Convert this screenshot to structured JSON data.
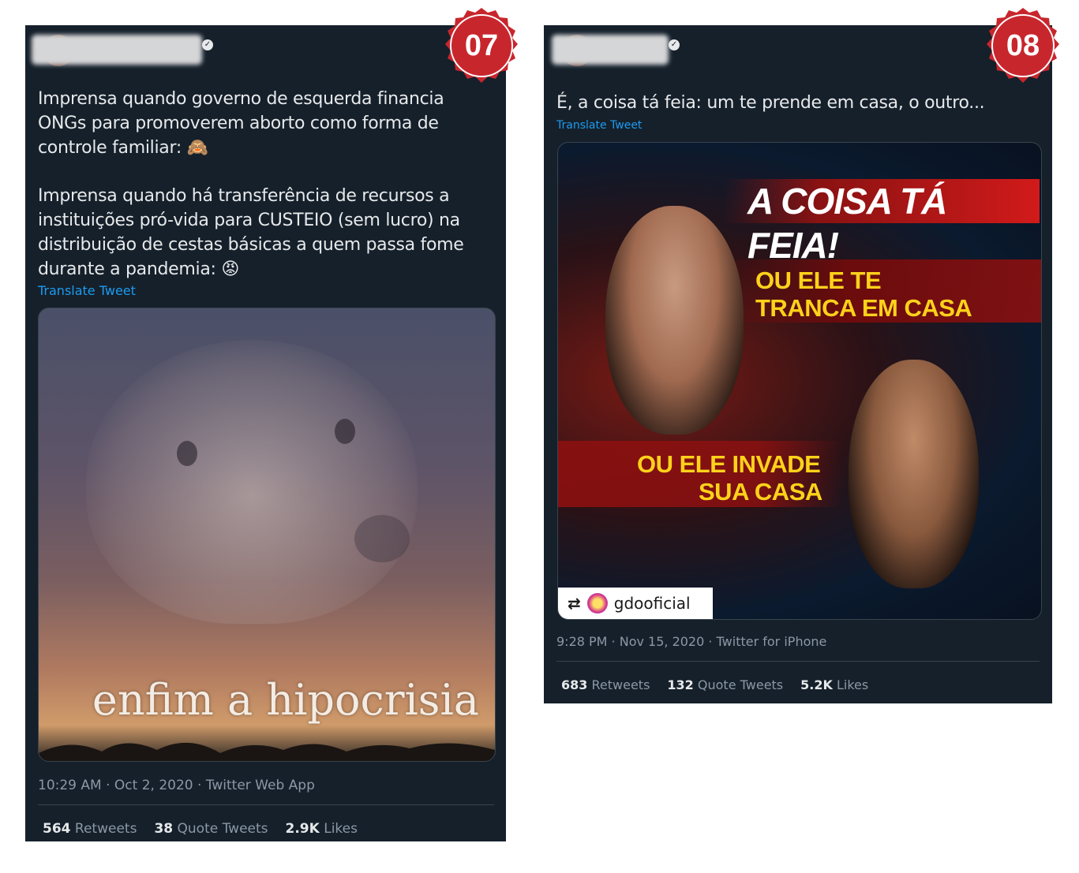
{
  "tweets": [
    {
      "badge": "07",
      "text_paragraphs": [
        "Imprensa quando governo de esquerda financia ONGs para promoverem aborto como forma de controle familiar: 🙈",
        "Imprensa quando há transferência de recursos a instituições pró-vida para CUSTEIO (sem lucro) na distribuição de cestas básicas a quem passa fome durante a pandemia: 😡"
      ],
      "translate_label": "Translate Tweet",
      "image_caption": "enfim a hipocrisia",
      "timestamp": "10:29 AM · Oct 2, 2020 · Twitter Web App",
      "stats": {
        "retweets_count": "564",
        "retweets_label": "Retweets",
        "quotes_count": "38",
        "quotes_label": "Quote Tweets",
        "likes_count": "2.9K",
        "likes_label": "Likes"
      }
    },
    {
      "badge": "08",
      "text_paragraphs": [
        "É, a coisa tá feia: um te prende em casa, o outro..."
      ],
      "translate_label": "Translate Tweet",
      "image_headline": "A COISA TÁ FEIA!",
      "image_line1": "OU ELE TE",
      "image_line2": "TRANCA EM CASA",
      "image_line3": "OU ELE INVADE",
      "image_line4": "SUA CASA",
      "attribution_handle": "gdooficial",
      "timestamp": "9:28 PM · Nov 15, 2020 · Twitter for iPhone",
      "stats": {
        "retweets_count": "683",
        "retweets_label": "Retweets",
        "quotes_count": "132",
        "quotes_label": "Quote Tweets",
        "likes_count": "5.2K",
        "likes_label": "Likes"
      }
    }
  ],
  "colors": {
    "tweet_background": "#15202b",
    "link_blue": "#1d9bf0",
    "badge_red": "#c8262d",
    "headline_yellow": "#ffd21a"
  }
}
